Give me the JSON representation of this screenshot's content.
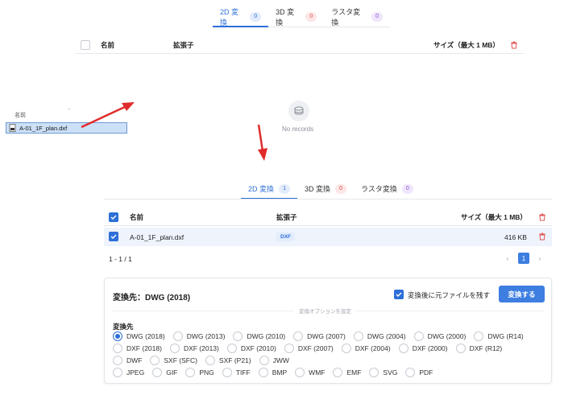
{
  "top": {
    "tabs": [
      {
        "label": "2D 変換",
        "count": "0"
      },
      {
        "label": "3D 変換",
        "count": "0"
      },
      {
        "label": "ラスタ変換",
        "count": "0"
      }
    ],
    "headers": {
      "name": "名前",
      "ext": "拡張子",
      "size": "サイズ（最大 1 MB）"
    },
    "empty_text": "No records"
  },
  "explorer": {
    "column_label": "名前",
    "handle": "..",
    "file_name": "A-01_1F_plan.dxf"
  },
  "bottom": {
    "tabs": [
      {
        "label": "2D 変換",
        "count": "1"
      },
      {
        "label": "3D 変換",
        "count": "0"
      },
      {
        "label": "ラスタ変換",
        "count": "0"
      }
    ],
    "headers": {
      "name": "名前",
      "ext": "拡張子",
      "size": "サイズ（最大 1 MB）"
    },
    "rows": [
      {
        "name": "A-01_1F_plan.dxf",
        "ext": "DXF",
        "size": "416 KB"
      }
    ],
    "range": "1 - 1 / 1",
    "page": "1",
    "prev": "‹",
    "next": "›"
  },
  "conversion": {
    "target_label": "変換先：DWG (2018)",
    "keep_original_label": "変換後に元ファイルを残す",
    "keep_original_checked": true,
    "convert_button": "変換する",
    "options_divider": "変換オプションを設定",
    "section_label": "変換先",
    "selected": "DWG (2018)",
    "rows": [
      [
        "DWG (2018)",
        "DWG (2013)",
        "DWG (2010)",
        "DWG (2007)",
        "DWG (2004)",
        "DWG (2000)",
        "DWG (R14)"
      ],
      [
        "DXF (2018)",
        "DXF (2013)",
        "DXF (2010)",
        "DXF (2007)",
        "DXF (2004)",
        "DXF (2000)",
        "DXF (R12)"
      ],
      [
        "DWF",
        "SXF (SFC)",
        "SXF (P21)",
        "JWW"
      ],
      [
        "JPEG",
        "GIF",
        "PNG",
        "TIFF",
        "BMP",
        "WMF",
        "EMF",
        "SVG",
        "PDF"
      ]
    ]
  },
  "colors": {
    "accent": "#2e6fd8",
    "arrow": "#e02b2b",
    "danger": "#e05555"
  }
}
